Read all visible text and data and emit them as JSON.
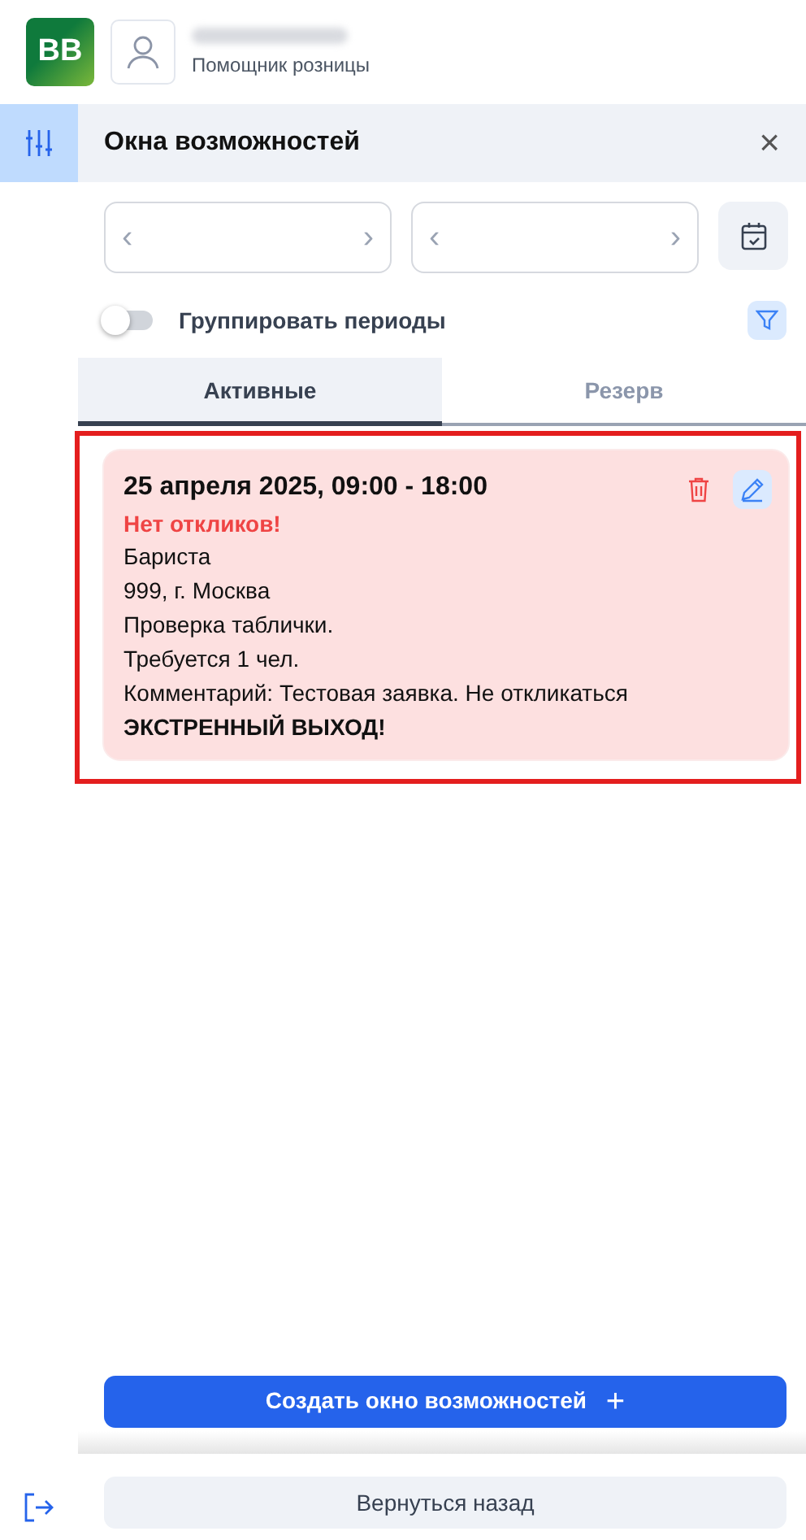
{
  "header": {
    "logo": "BB",
    "role": "Помощник розницы"
  },
  "panel": {
    "title": "Окна возможностей",
    "close": "×"
  },
  "date_fields": [
    {
      "prev": "‹",
      "next": "›"
    },
    {
      "prev": "‹",
      "next": "›"
    }
  ],
  "group_toggle": {
    "label": "Группировать периоды",
    "on": false
  },
  "tabs": [
    {
      "label": "Активные",
      "selected": true
    },
    {
      "label": "Резерв",
      "selected": false
    }
  ],
  "cards": [
    {
      "outlined": true,
      "lines": [
        {
          "kind": "title",
          "text": "25 апреля 2025, 09:00 - 18:00"
        },
        {
          "kind": "alert",
          "text": "Нет откликов!"
        },
        {
          "kind": "text",
          "text": "Бариста"
        },
        {
          "kind": "text",
          "text": "999, г. Москва"
        },
        {
          "kind": "text",
          "text": "Проверка таблички."
        },
        {
          "kind": "text",
          "text": "Требуется 1 чел."
        },
        {
          "kind": "text",
          "text": "Комментарий: Тестовая заявка. Не откликаться"
        },
        {
          "kind": "emphasis",
          "text": "ЭКСТРЕННЫЙ ВЫХОД!"
        }
      ]
    }
  ],
  "create_button": {
    "label": "Создать окно возможностей",
    "icon": "+"
  },
  "back_button": {
    "label": "Вернуться назад"
  }
}
